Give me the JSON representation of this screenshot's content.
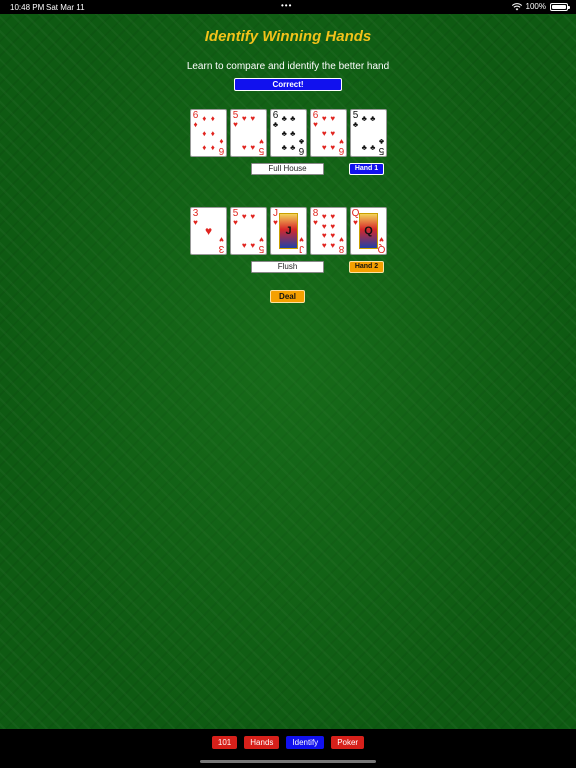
{
  "status_bar": {
    "time": "10:48 PM",
    "date": "Sat Mar 11",
    "dots": "•••",
    "battery": "100%",
    "battery_level": 1.0
  },
  "title": "Identify Winning Hands",
  "subtitle": "Learn to compare and identify the better hand",
  "result": "Correct!",
  "hand1": {
    "cards": [
      {
        "rank": "6",
        "suit": "♦",
        "color": "red"
      },
      {
        "rank": "5",
        "suit": "♥",
        "color": "red"
      },
      {
        "rank": "6",
        "suit": "♣",
        "color": "black"
      },
      {
        "rank": "6",
        "suit": "♥",
        "color": "red"
      },
      {
        "rank": "5",
        "suit": "♣",
        "color": "black"
      }
    ],
    "hand_name": "Full House",
    "button": "Hand 1"
  },
  "hand2": {
    "cards": [
      {
        "rank": "3",
        "suit": "♥",
        "color": "red"
      },
      {
        "rank": "5",
        "suit": "♥",
        "color": "red"
      },
      {
        "rank": "J",
        "suit": "♥",
        "color": "red"
      },
      {
        "rank": "8",
        "suit": "♥",
        "color": "red"
      },
      {
        "rank": "Q",
        "suit": "♥",
        "color": "red"
      }
    ],
    "hand_name": "Flush",
    "button": "Hand 2"
  },
  "deal_label": "Deal",
  "tabs": [
    {
      "label": "101",
      "color": "red"
    },
    {
      "label": "Hands",
      "color": "red"
    },
    {
      "label": "Identify",
      "color": "blue"
    },
    {
      "label": "Poker",
      "color": "red"
    }
  ],
  "colors": {
    "felt": "#0e5a12",
    "title": "#f2c21a",
    "blue": "#1111ee",
    "orange": "#f5a000",
    "red": "#d7201a"
  }
}
